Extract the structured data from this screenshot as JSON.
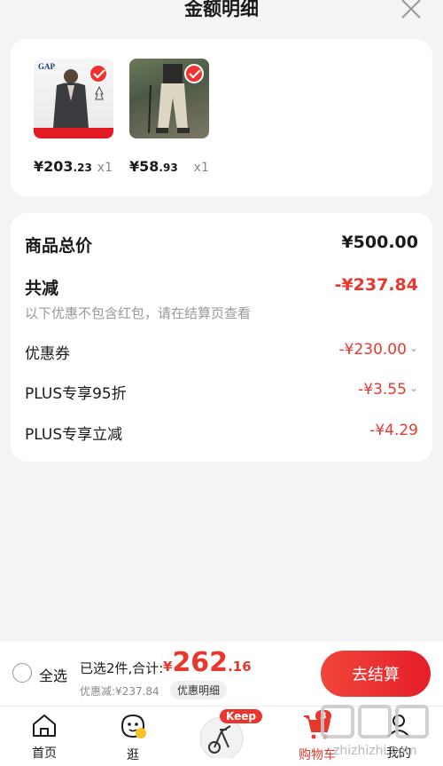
{
  "header": {
    "title": "金额明细"
  },
  "products": [
    {
      "price_int": "¥203",
      "price_dec": ".23",
      "qty": "x1",
      "brand": "GAP"
    },
    {
      "price_int": "¥58",
      "price_dec": ".93",
      "qty": "x1"
    }
  ],
  "summary": {
    "goods_total_label": "商品总价",
    "goods_total_value": "¥500.00",
    "reduction_label": "共减",
    "reduction_value": "-¥237.84",
    "reduction_note": "以下优惠不包含红包，请在结算页查看",
    "items": [
      {
        "label": "优惠券",
        "value": "-¥230.00",
        "expandable": true
      },
      {
        "label": "PLUS专享95折",
        "value": "-¥3.55",
        "expandable": true
      },
      {
        "label": "PLUS专享立减",
        "value": "-¥4.29",
        "expandable": false
      }
    ]
  },
  "checkout": {
    "select_all": "全选",
    "selected_count": "已选2件,合计:",
    "total_currency": "¥",
    "total_int": "262",
    "total_dec": ".16",
    "discount_text": "优惠减:¥237.84",
    "detail_button": "优惠明细",
    "checkout_button": "去结算"
  },
  "tabbar": {
    "items": [
      {
        "label": "首页",
        "icon": "home-icon"
      },
      {
        "label": "逛",
        "icon": "stroll-icon"
      },
      {
        "label": "",
        "icon": "keep-bike-icon",
        "badge": "Keep"
      },
      {
        "label": "购物车",
        "icon": "cart-icon",
        "badge": "3"
      },
      {
        "label": "我的",
        "icon": "user-icon"
      }
    ]
  },
  "watermark": "zhizhizhi.com",
  "colors": {
    "accent": "#e8382e",
    "background": "#f4f4f4"
  }
}
